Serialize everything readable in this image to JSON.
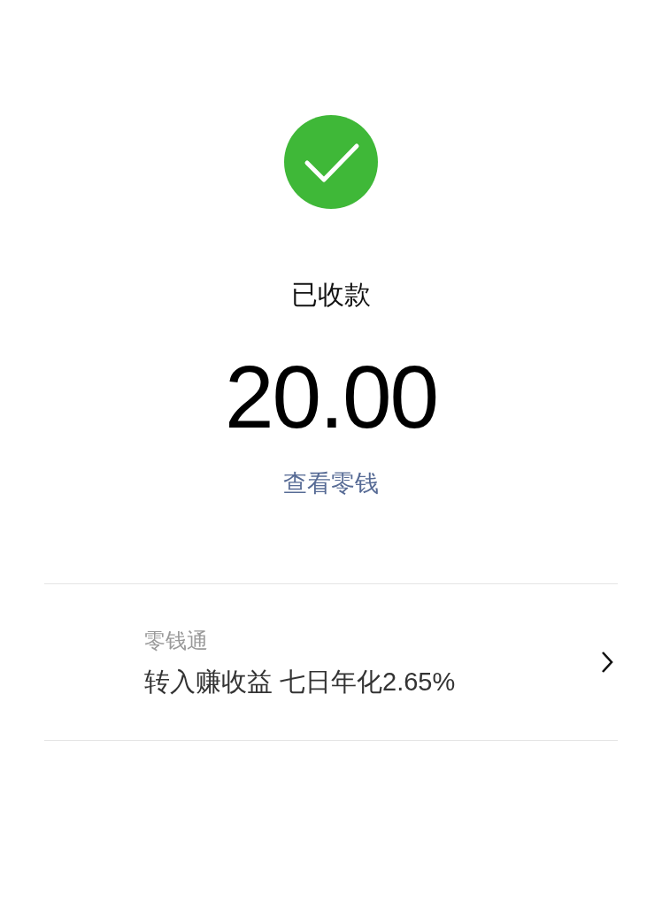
{
  "status": {
    "title": "已收款",
    "amount": "20.00",
    "link": "查看零钱"
  },
  "promo": {
    "title": "零钱通",
    "text": "转入赚收益 七日年化2.65%"
  }
}
